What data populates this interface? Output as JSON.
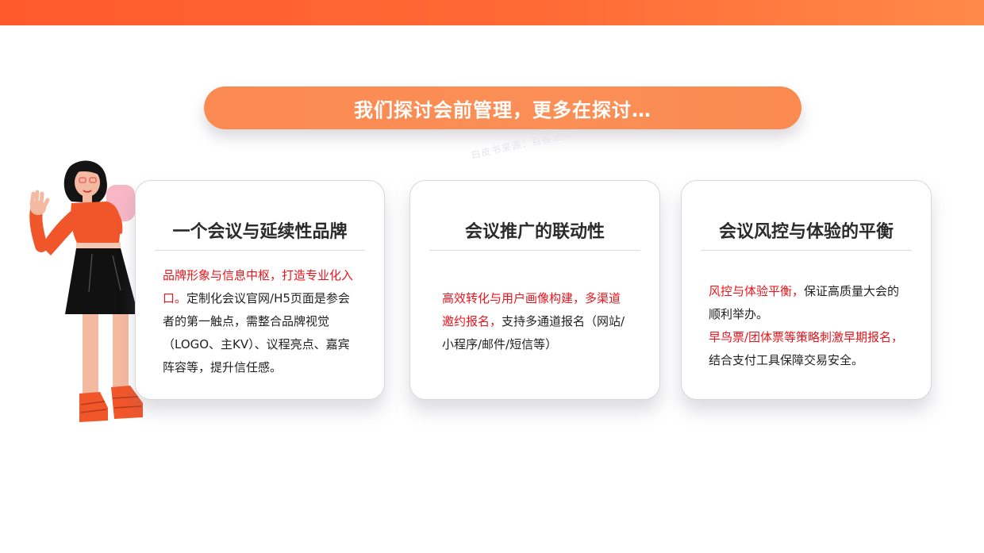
{
  "title": "我们探讨会前管理，更多在探讨…",
  "watermark": "白皮书来源：百格活动",
  "cards": [
    {
      "title": "一个会议与延续性品牌",
      "highlight": "品牌形象与信息中枢，打造专业化入口。",
      "text": "定制化会议官网/H5页面是参会者的第一触点，需整合品牌视觉（LOGO、主KV）、议程亮点、嘉宾阵容等，提升信任感。"
    },
    {
      "title": "会议推广的联动性",
      "highlight": "高效转化与用户画像构建，多渠道邀约报名，",
      "text": "支持多通道报名（网站/小程序/邮件/短信等）"
    },
    {
      "title": "会议风控与体验的平衡",
      "highlight": "风控与体验平衡，",
      "text": "保证高质量大会的顺利举办。",
      "highlight2": "早鸟票/团体票等策略刺激早期报名，",
      "text2": "结合支付工具保障交易安全。"
    }
  ],
  "colors": {
    "top_bar": "#ff5a2c",
    "pill": "#fb8a52",
    "highlight": "#e8161c",
    "shirt": "#f0562a",
    "skirt": "#111111",
    "skin": "#f4b9a1"
  }
}
